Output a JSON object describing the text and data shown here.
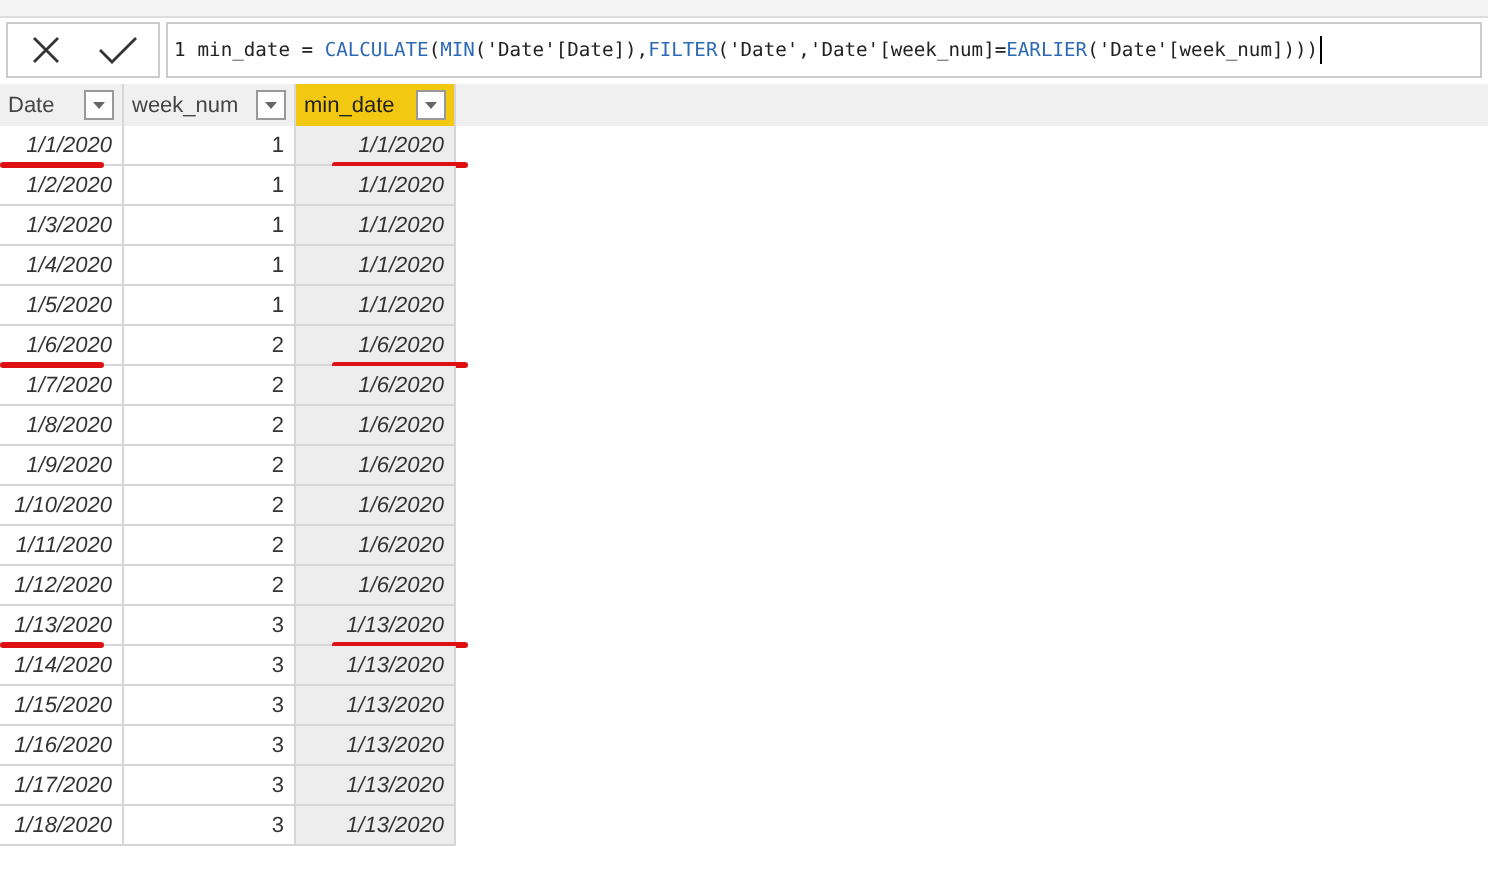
{
  "formula_bar": {
    "line_number": "1",
    "tokens": [
      {
        "kind": "text",
        "text": "min_date = "
      },
      {
        "kind": "function",
        "text": "CALCULATE"
      },
      {
        "kind": "text",
        "text": "("
      },
      {
        "kind": "function",
        "text": "MIN"
      },
      {
        "kind": "text",
        "text": "('Date'[Date]),"
      },
      {
        "kind": "function",
        "text": "FILTER"
      },
      {
        "kind": "text",
        "text": "('Date','Date'[week_num]="
      },
      {
        "kind": "function",
        "text": "EARLIER"
      },
      {
        "kind": "text",
        "text": "('Date'[week_num])))"
      }
    ]
  },
  "table": {
    "columns": [
      {
        "label": "Date",
        "selected": false
      },
      {
        "label": "week_num",
        "selected": false
      },
      {
        "label": "min_date",
        "selected": true
      }
    ],
    "rows": [
      {
        "cells": [
          "1/1/2020",
          "1",
          "1/1/2020"
        ],
        "underlined": true
      },
      {
        "cells": [
          "1/2/2020",
          "1",
          "1/1/2020"
        ],
        "underlined": false
      },
      {
        "cells": [
          "1/3/2020",
          "1",
          "1/1/2020"
        ],
        "underlined": false
      },
      {
        "cells": [
          "1/4/2020",
          "1",
          "1/1/2020"
        ],
        "underlined": false
      },
      {
        "cells": [
          "1/5/2020",
          "1",
          "1/1/2020"
        ],
        "underlined": false
      },
      {
        "cells": [
          "1/6/2020",
          "2",
          "1/6/2020"
        ],
        "underlined": true
      },
      {
        "cells": [
          "1/7/2020",
          "2",
          "1/6/2020"
        ],
        "underlined": false
      },
      {
        "cells": [
          "1/8/2020",
          "2",
          "1/6/2020"
        ],
        "underlined": false
      },
      {
        "cells": [
          "1/9/2020",
          "2",
          "1/6/2020"
        ],
        "underlined": false
      },
      {
        "cells": [
          "1/10/2020",
          "2",
          "1/6/2020"
        ],
        "underlined": false
      },
      {
        "cells": [
          "1/11/2020",
          "2",
          "1/6/2020"
        ],
        "underlined": false
      },
      {
        "cells": [
          "1/12/2020",
          "2",
          "1/6/2020"
        ],
        "underlined": false
      },
      {
        "cells": [
          "1/13/2020",
          "3",
          "1/13/2020"
        ],
        "underlined": true
      },
      {
        "cells": [
          "1/14/2020",
          "3",
          "1/13/2020"
        ],
        "underlined": false
      },
      {
        "cells": [
          "1/15/2020",
          "3",
          "1/13/2020"
        ],
        "underlined": false
      },
      {
        "cells": [
          "1/16/2020",
          "3",
          "1/13/2020"
        ],
        "underlined": false
      },
      {
        "cells": [
          "1/17/2020",
          "3",
          "1/13/2020"
        ],
        "underlined": false
      },
      {
        "cells": [
          "1/18/2020",
          "3",
          "1/13/2020"
        ],
        "underlined": false
      }
    ]
  }
}
